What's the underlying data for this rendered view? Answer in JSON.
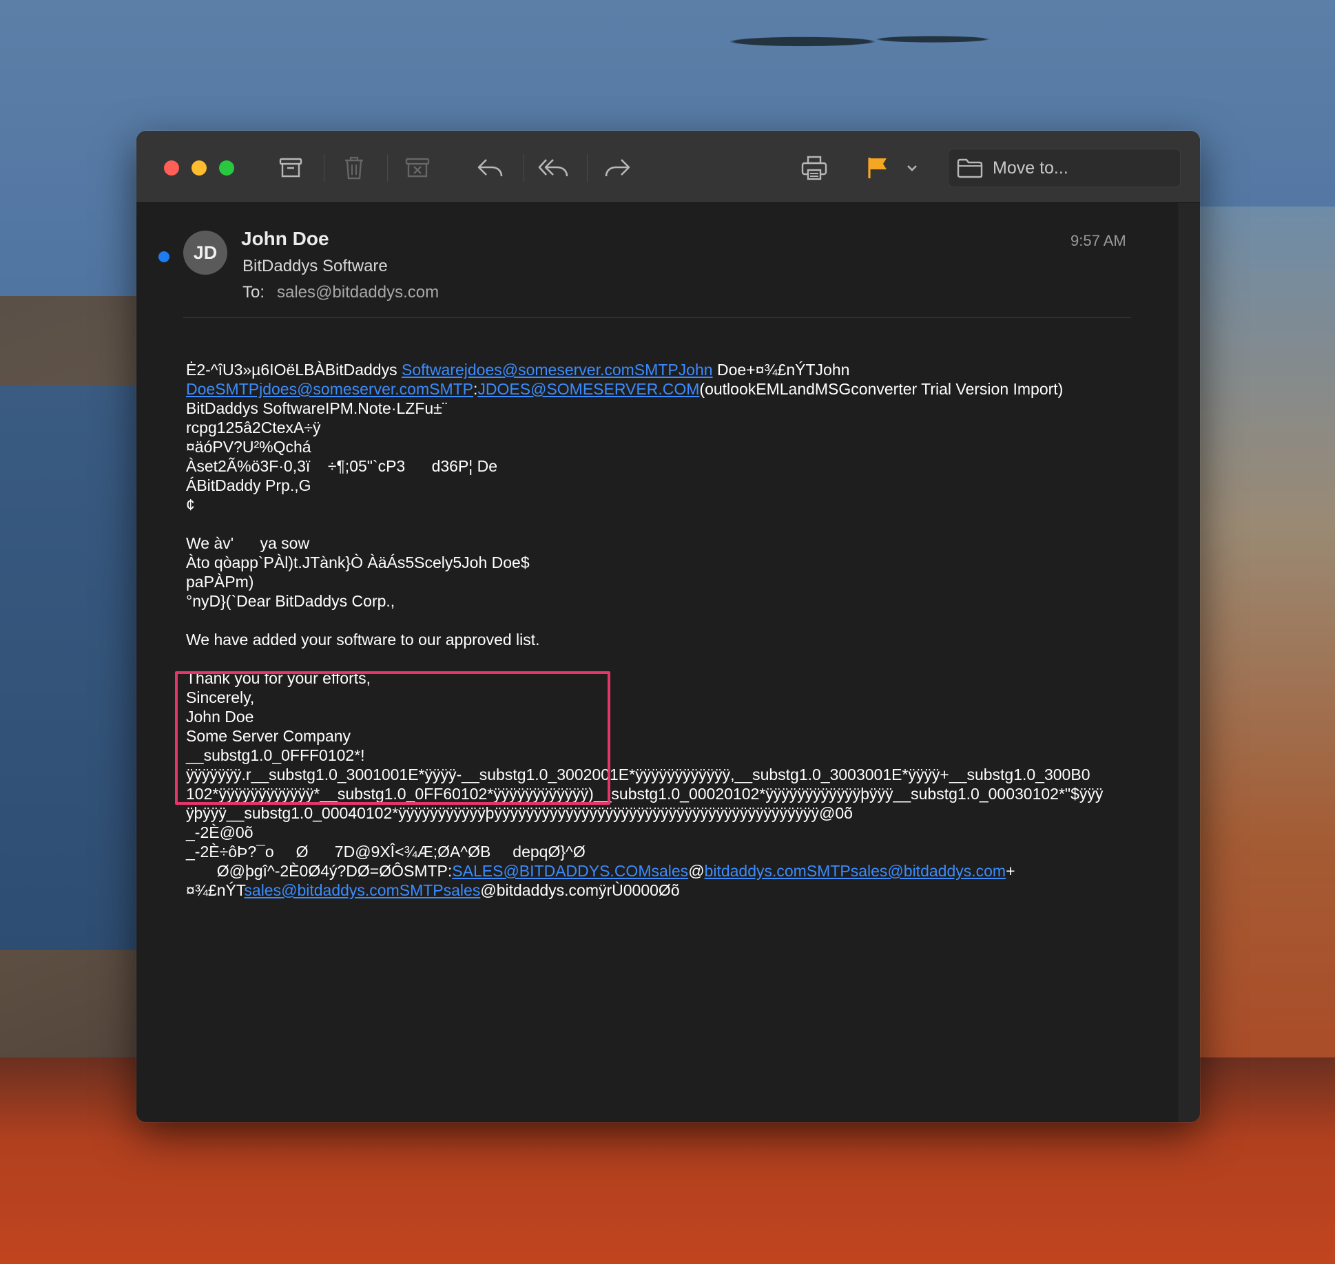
{
  "toolbar": {
    "icons": [
      "archive-icon",
      "trash-icon",
      "junk-icon",
      "reply-icon",
      "reply-all-icon",
      "forward-icon",
      "print-icon",
      "flag-icon",
      "chevron-down-icon",
      "folder-icon"
    ],
    "move_to_label": "Move to...",
    "flag_color": "#f5a623"
  },
  "header": {
    "avatar_initials": "JD",
    "sender_name": "John Doe",
    "sender_company": "BitDaddys Software",
    "to_label": "To:",
    "to_value": "sales@bitdaddys.com",
    "time": "9:57 AM"
  },
  "body": {
    "line1a": "Ė2-^îU3»µ6IOëLBÀBitDaddys ",
    "line1link": "Softwarejdoes@someserver.comSMTPJohn",
    "line1b": " Doe+¤¾£nÝTJohn",
    "line2link1": "DoeSMTPjdoes@someserver.comSMTP",
    "line2sep": ":",
    "line2link2": "JDOES@SOMESERVER.COM",
    "line2b": "(outlookEMLandMSGconverter Trial Version Import)",
    "line3": "BitDaddys SoftwareIPM.Note·LZFu±¨",
    "line4": "rcpg125â2CtexA÷ÿ",
    "line5": "¤äóPV?U²%Qchá",
    "line6": "Àset2Ã%ö3F·0,3ï    ÷¶;05\"`cP3      d36P¦ De",
    "line7": "ÁBitDaddy Prp.,G",
    "line8": "¢",
    "line9": "",
    "line10": "We àv'      ya sow",
    "line11": "Àto qòapp`PÀl)t.JTànk}Ò ÀäÁs5Scely5Joh Doe$",
    "line12": "paPÀPm)",
    "line13": "°nyD}(`Dear BitDaddys Corp.,",
    "line14": "",
    "line15": "We have added your software to our approved list.",
    "line16": "",
    "line17": "Thank you for your efforts,",
    "line18": "Sincerely,",
    "line19": "John Doe",
    "line20": "Some Server Company",
    "line21": "__substg1.0_0FFF0102*!",
    "line22": "ÿÿÿÿÿÿÿ.r__substg1.0_3001001E*ÿÿÿÿ-__substg1.0_3002001E*ÿÿÿÿÿÿÿÿÿÿÿÿ,__substg1.0_3003001E*ÿÿÿÿ+__substg1.0_300B0",
    "line23": "102*ÿÿÿÿÿÿÿÿÿÿÿÿ*__substg1.0_0FF60102*ÿÿÿÿÿÿÿÿÿÿÿÿ)__substg1.0_00020102*ÿÿÿÿÿÿÿÿÿÿÿÿþÿÿÿ__substg1.0_00030102*\"$ÿÿÿ",
    "line24": "ÿþÿÿÿ__substg1.0_00040102*ÿÿÿÿÿÿÿÿÿÿÿþÿÿÿÿÿÿÿÿÿÿÿÿÿÿÿÿÿÿÿÿÿÿÿÿÿÿÿÿÿÿÿÿÿÿÿÿÿÿÿÿÿ@0õ",
    "line25": "_-2È@0õ",
    "line26": "_-2È÷ôÞ?¯o     Ø      7D@9XÎ<¾Æ;ØA^ØB     depqØ}^Ø",
    "line27a": "       Ø@þgî^-2È0Ø4ý?DØ=ØÔSMTP:",
    "line27link1": "SALES@BITDADDYS.COMsales",
    "line27at": "@",
    "line27link2": "bitdaddys.comSMTPsales@bitdaddys.com",
    "line27b": "+",
    "line28a": "¤¾£nÝT",
    "line28link": "sales@bitdaddys.comSMTPsales",
    "line28b": "@bitdaddys.comÿrÙ0000Øõ"
  }
}
